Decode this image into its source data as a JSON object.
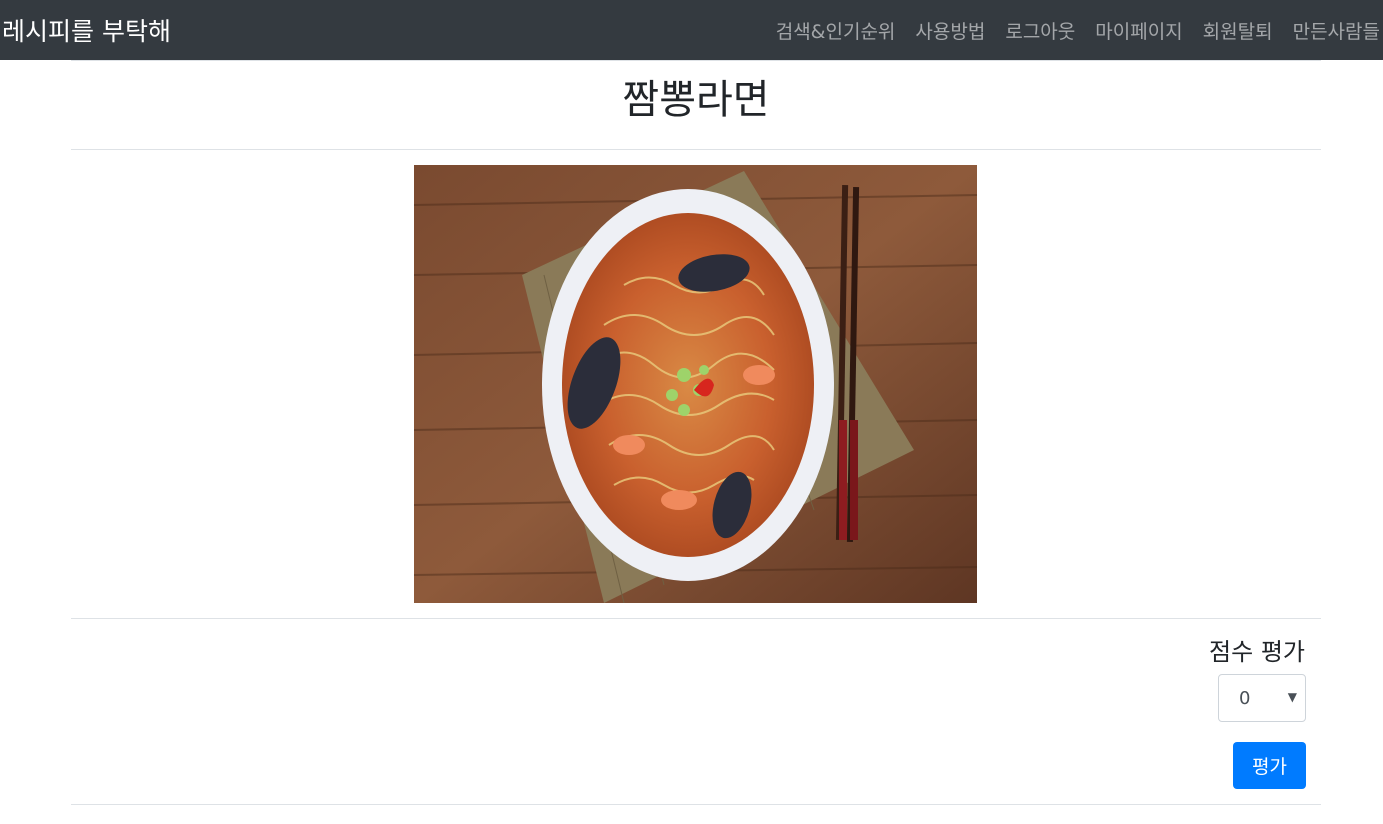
{
  "navbar": {
    "brand": "레시피를 부탁해",
    "links": [
      "검색&인기순위",
      "사용방법",
      "로그아웃",
      "마이페이지",
      "회원탈퇴",
      "만든사람들"
    ]
  },
  "recipe": {
    "title": "짬뽕라면"
  },
  "rating": {
    "label": "점수 평가",
    "selected_value": "0",
    "submit_label": "평가"
  },
  "colors": {
    "navbar_bg": "#343a40",
    "primary_button": "#007bff"
  }
}
